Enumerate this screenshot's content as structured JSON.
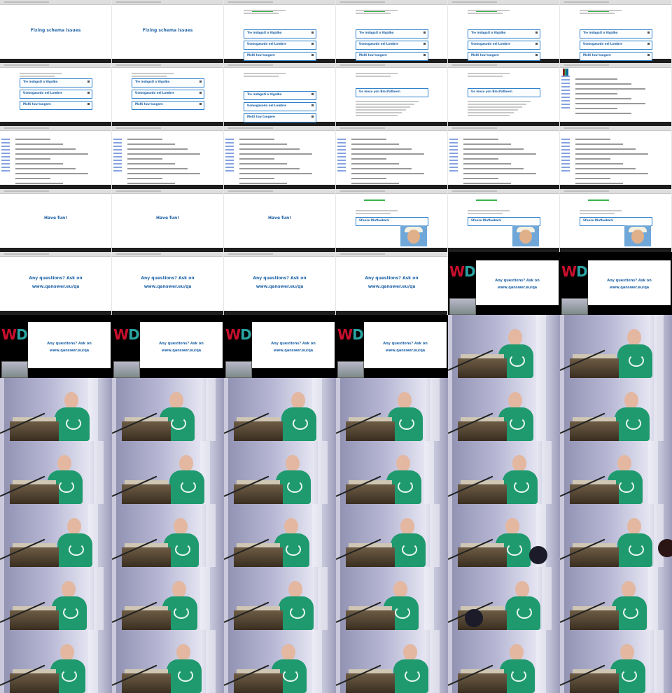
{
  "slides": {
    "fixing_schema": "Fixing schema issues",
    "have_fun": "Have fun!",
    "questions_line1": "Any questions? Ask on",
    "questions_line2": "www.qanswer.eu/qa",
    "boxes": [
      "Tre indagati a Vigalbo",
      "Uomogasodo nel Lombre",
      "Molti tsw tangere"
    ],
    "single_box": "Uo moso yon Bloritafluern",
    "profile_box": "Sfonso Dlafluebark"
  },
  "colors": {
    "slide_text": "#1f63a6",
    "box_border": "#2f80c8",
    "tshirt": "#1f9a6e",
    "progress": "#3ab34a"
  },
  "icons": [
    "wikidata-logo-icon",
    "conference-logo-icon"
  ]
}
